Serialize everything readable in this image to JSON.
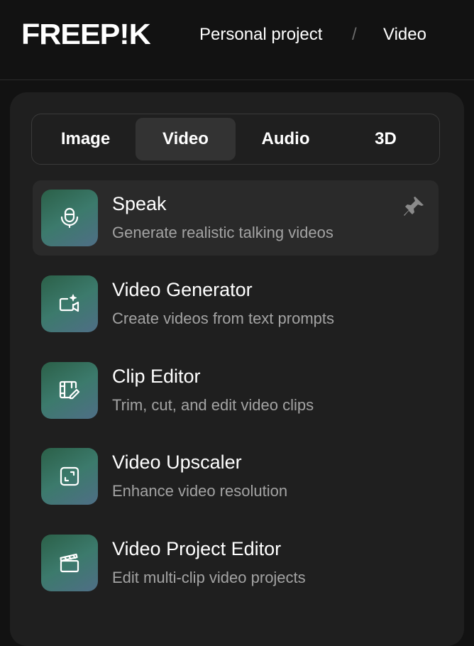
{
  "header": {
    "logo_text": "FREEP!K",
    "breadcrumb": [
      "Personal project",
      "/",
      "Video"
    ]
  },
  "tabs": [
    {
      "label": "Image",
      "active": false
    },
    {
      "label": "Video",
      "active": true
    },
    {
      "label": "Audio",
      "active": false
    },
    {
      "label": "3D",
      "active": false
    }
  ],
  "tools": [
    {
      "title": "Speak",
      "description": "Generate realistic talking videos",
      "icon": "microphone-face-icon",
      "highlighted": true,
      "pinned": true
    },
    {
      "title": "Video Generator",
      "description": "Create videos from text prompts",
      "icon": "video-sparkle-icon",
      "highlighted": false
    },
    {
      "title": "Clip Editor",
      "description": "Trim, cut, and edit video clips",
      "icon": "film-edit-icon",
      "highlighted": false
    },
    {
      "title": "Video Upscaler",
      "description": "Enhance video resolution",
      "icon": "expand-icon",
      "highlighted": false
    },
    {
      "title": "Video Project Editor",
      "description": "Edit multi-clip video projects",
      "icon": "clapperboard-icon",
      "highlighted": false
    }
  ],
  "colors": {
    "background": "#121212",
    "panel": "#1f1f1f",
    "active_tab": "#333333",
    "highlight_row": "#2a2a2a",
    "secondary_text": "#a3a3a3"
  }
}
